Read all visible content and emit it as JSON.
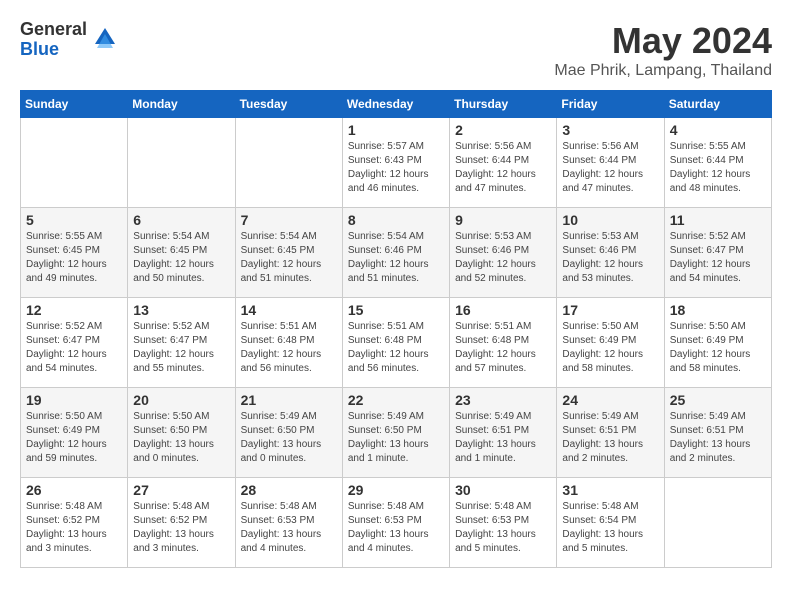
{
  "logo": {
    "general": "General",
    "blue": "Blue"
  },
  "title": "May 2024",
  "subtitle": "Mae Phrik, Lampang, Thailand",
  "days_of_week": [
    "Sunday",
    "Monday",
    "Tuesday",
    "Wednesday",
    "Thursday",
    "Friday",
    "Saturday"
  ],
  "weeks": [
    [
      {
        "day": null,
        "info": null
      },
      {
        "day": null,
        "info": null
      },
      {
        "day": null,
        "info": null
      },
      {
        "day": "1",
        "info": "Sunrise: 5:57 AM\nSunset: 6:43 PM\nDaylight: 12 hours\nand 46 minutes."
      },
      {
        "day": "2",
        "info": "Sunrise: 5:56 AM\nSunset: 6:44 PM\nDaylight: 12 hours\nand 47 minutes."
      },
      {
        "day": "3",
        "info": "Sunrise: 5:56 AM\nSunset: 6:44 PM\nDaylight: 12 hours\nand 47 minutes."
      },
      {
        "day": "4",
        "info": "Sunrise: 5:55 AM\nSunset: 6:44 PM\nDaylight: 12 hours\nand 48 minutes."
      }
    ],
    [
      {
        "day": "5",
        "info": "Sunrise: 5:55 AM\nSunset: 6:45 PM\nDaylight: 12 hours\nand 49 minutes."
      },
      {
        "day": "6",
        "info": "Sunrise: 5:54 AM\nSunset: 6:45 PM\nDaylight: 12 hours\nand 50 minutes."
      },
      {
        "day": "7",
        "info": "Sunrise: 5:54 AM\nSunset: 6:45 PM\nDaylight: 12 hours\nand 51 minutes."
      },
      {
        "day": "8",
        "info": "Sunrise: 5:54 AM\nSunset: 6:46 PM\nDaylight: 12 hours\nand 51 minutes."
      },
      {
        "day": "9",
        "info": "Sunrise: 5:53 AM\nSunset: 6:46 PM\nDaylight: 12 hours\nand 52 minutes."
      },
      {
        "day": "10",
        "info": "Sunrise: 5:53 AM\nSunset: 6:46 PM\nDaylight: 12 hours\nand 53 minutes."
      },
      {
        "day": "11",
        "info": "Sunrise: 5:52 AM\nSunset: 6:47 PM\nDaylight: 12 hours\nand 54 minutes."
      }
    ],
    [
      {
        "day": "12",
        "info": "Sunrise: 5:52 AM\nSunset: 6:47 PM\nDaylight: 12 hours\nand 54 minutes."
      },
      {
        "day": "13",
        "info": "Sunrise: 5:52 AM\nSunset: 6:47 PM\nDaylight: 12 hours\nand 55 minutes."
      },
      {
        "day": "14",
        "info": "Sunrise: 5:51 AM\nSunset: 6:48 PM\nDaylight: 12 hours\nand 56 minutes."
      },
      {
        "day": "15",
        "info": "Sunrise: 5:51 AM\nSunset: 6:48 PM\nDaylight: 12 hours\nand 56 minutes."
      },
      {
        "day": "16",
        "info": "Sunrise: 5:51 AM\nSunset: 6:48 PM\nDaylight: 12 hours\nand 57 minutes."
      },
      {
        "day": "17",
        "info": "Sunrise: 5:50 AM\nSunset: 6:49 PM\nDaylight: 12 hours\nand 58 minutes."
      },
      {
        "day": "18",
        "info": "Sunrise: 5:50 AM\nSunset: 6:49 PM\nDaylight: 12 hours\nand 58 minutes."
      }
    ],
    [
      {
        "day": "19",
        "info": "Sunrise: 5:50 AM\nSunset: 6:49 PM\nDaylight: 12 hours\nand 59 minutes."
      },
      {
        "day": "20",
        "info": "Sunrise: 5:50 AM\nSunset: 6:50 PM\nDaylight: 13 hours\nand 0 minutes."
      },
      {
        "day": "21",
        "info": "Sunrise: 5:49 AM\nSunset: 6:50 PM\nDaylight: 13 hours\nand 0 minutes."
      },
      {
        "day": "22",
        "info": "Sunrise: 5:49 AM\nSunset: 6:50 PM\nDaylight: 13 hours\nand 1 minute."
      },
      {
        "day": "23",
        "info": "Sunrise: 5:49 AM\nSunset: 6:51 PM\nDaylight: 13 hours\nand 1 minute."
      },
      {
        "day": "24",
        "info": "Sunrise: 5:49 AM\nSunset: 6:51 PM\nDaylight: 13 hours\nand 2 minutes."
      },
      {
        "day": "25",
        "info": "Sunrise: 5:49 AM\nSunset: 6:51 PM\nDaylight: 13 hours\nand 2 minutes."
      }
    ],
    [
      {
        "day": "26",
        "info": "Sunrise: 5:48 AM\nSunset: 6:52 PM\nDaylight: 13 hours\nand 3 minutes."
      },
      {
        "day": "27",
        "info": "Sunrise: 5:48 AM\nSunset: 6:52 PM\nDaylight: 13 hours\nand 3 minutes."
      },
      {
        "day": "28",
        "info": "Sunrise: 5:48 AM\nSunset: 6:53 PM\nDaylight: 13 hours\nand 4 minutes."
      },
      {
        "day": "29",
        "info": "Sunrise: 5:48 AM\nSunset: 6:53 PM\nDaylight: 13 hours\nand 4 minutes."
      },
      {
        "day": "30",
        "info": "Sunrise: 5:48 AM\nSunset: 6:53 PM\nDaylight: 13 hours\nand 5 minutes."
      },
      {
        "day": "31",
        "info": "Sunrise: 5:48 AM\nSunset: 6:54 PM\nDaylight: 13 hours\nand 5 minutes."
      },
      {
        "day": null,
        "info": null
      }
    ]
  ]
}
